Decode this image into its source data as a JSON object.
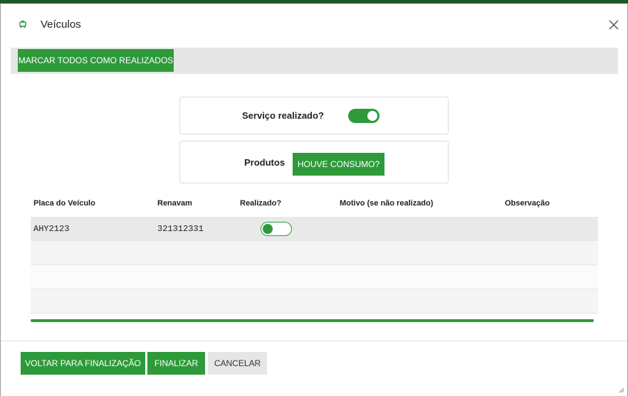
{
  "window": {
    "title": "Veículos",
    "icon": "car-icon",
    "close_icon": "close-icon"
  },
  "toolbar": {
    "mark_all_label": "MARCAR TODOS COMO REALIZADOS"
  },
  "service": {
    "label": "Serviço realizado?",
    "toggle_on": true
  },
  "products": {
    "label": "Produtos",
    "button_label": "HOUVE CONSUMO?"
  },
  "table": {
    "headers": [
      "Placa do Veículo",
      "Renavam",
      "Realizado?",
      "Motivo (se não realizado)",
      "Observação"
    ],
    "rows": [
      {
        "placa": "AHY2123",
        "renavam": "321312331",
        "realizado": false,
        "motivo": "",
        "observacao": ""
      }
    ]
  },
  "progress": {
    "fraction": 1.0
  },
  "footer": {
    "back_label": "VOLTAR PARA FINALIZAÇÃO",
    "finish_label": "FINALIZAR",
    "cancel_label": "CANCELAR"
  },
  "colors": {
    "accent": "#2e9a3a",
    "topbar": "#1d5a2a"
  }
}
